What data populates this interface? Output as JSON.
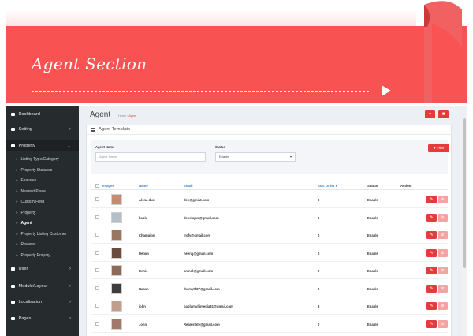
{
  "banner": {
    "title": "Agent Section"
  },
  "colors": {
    "accent": "#f95252",
    "sidebar_bg": "#262b2e",
    "danger": "#e53b3b",
    "link": "#3a7fc8"
  },
  "sidebar": {
    "items": [
      {
        "label": "Dashboard",
        "icon": "dashboard-icon",
        "type": "main",
        "chevron": ""
      },
      {
        "label": "Setting",
        "icon": "gear-icon",
        "type": "main",
        "chevron": "›"
      },
      {
        "label": "Property",
        "icon": "document-icon",
        "type": "main",
        "chevron": "⌄"
      },
      {
        "label": "Listing Type/Category",
        "type": "sub"
      },
      {
        "label": "Property Statuses",
        "type": "sub"
      },
      {
        "label": "Features",
        "type": "sub"
      },
      {
        "label": "Nearest Place",
        "type": "sub"
      },
      {
        "label": "Custom Field",
        "type": "sub"
      },
      {
        "label": "Property",
        "type": "sub"
      },
      {
        "label": "Agent",
        "type": "sub",
        "current": true
      },
      {
        "label": "Property Listing Customer",
        "type": "sub"
      },
      {
        "label": "Reviews",
        "type": "sub"
      },
      {
        "label": "Property Enquiry",
        "type": "sub"
      },
      {
        "label": "User",
        "icon": "user-icon",
        "type": "main",
        "chevron": "›"
      },
      {
        "label": "Module/Layout",
        "icon": "layout-icon",
        "type": "main",
        "chevron": "›"
      },
      {
        "label": "Localisation",
        "icon": "map-pin-icon",
        "type": "main",
        "chevron": "›"
      },
      {
        "label": "Pages",
        "icon": "pages-icon",
        "type": "main",
        "chevron": "›"
      }
    ]
  },
  "header": {
    "title": "Agent",
    "breadcrumb_home": "Home",
    "breadcrumb_sep": " › ",
    "breadcrumb_current": "Agent",
    "add_icon": "plus-icon",
    "delete_icon": "trash-icon"
  },
  "panel": {
    "title": "Agent Template",
    "filter": {
      "name_label": "Agent Name",
      "name_placeholder": "Agent Name",
      "status_label": "Status",
      "status_value": "Enable",
      "filter_button": "▼ Filter"
    },
    "columns": {
      "images": "Images",
      "name": "Name",
      "email": "Email",
      "sort_order": "Sort Order ▾",
      "status": "Status",
      "action": "Action"
    },
    "rows": [
      {
        "name": "Alena due",
        "email": "dev@gmiat.com",
        "sort_order": "0",
        "status": "Enable",
        "thumb_color": "#c78a6f"
      },
      {
        "name": "bablu",
        "email": "developer@gmail.com",
        "sort_order": "0",
        "status": "Enable",
        "thumb_color": "#b5bfc9"
      },
      {
        "name": "Champion",
        "email": "trofy@gmail.com",
        "sort_order": "0",
        "status": "Enable",
        "thumb_color": "#9a7660"
      },
      {
        "name": "Denim",
        "email": "neeraj@gmail.com",
        "sort_order": "0",
        "status": "Enable",
        "thumb_color": "#6b4b3d"
      },
      {
        "name": "Denis",
        "email": "anmol@gmail.com",
        "sort_order": "0",
        "status": "Enable",
        "thumb_color": "#8b6a5a"
      },
      {
        "name": "Hasan",
        "email": "themyth87@gmail.com",
        "sort_order": "0",
        "status": "Enable",
        "thumb_color": "#3d3d3d"
      },
      {
        "name": "john",
        "email": "bablumultimedia31@gmail.com",
        "sort_order": "3",
        "status": "Enable",
        "thumb_color": "#c0a08c"
      },
      {
        "name": "John",
        "email": "Realestate@gmail.com",
        "sort_order": "0",
        "status": "Enable",
        "thumb_color": "#a1786a"
      }
    ]
  }
}
